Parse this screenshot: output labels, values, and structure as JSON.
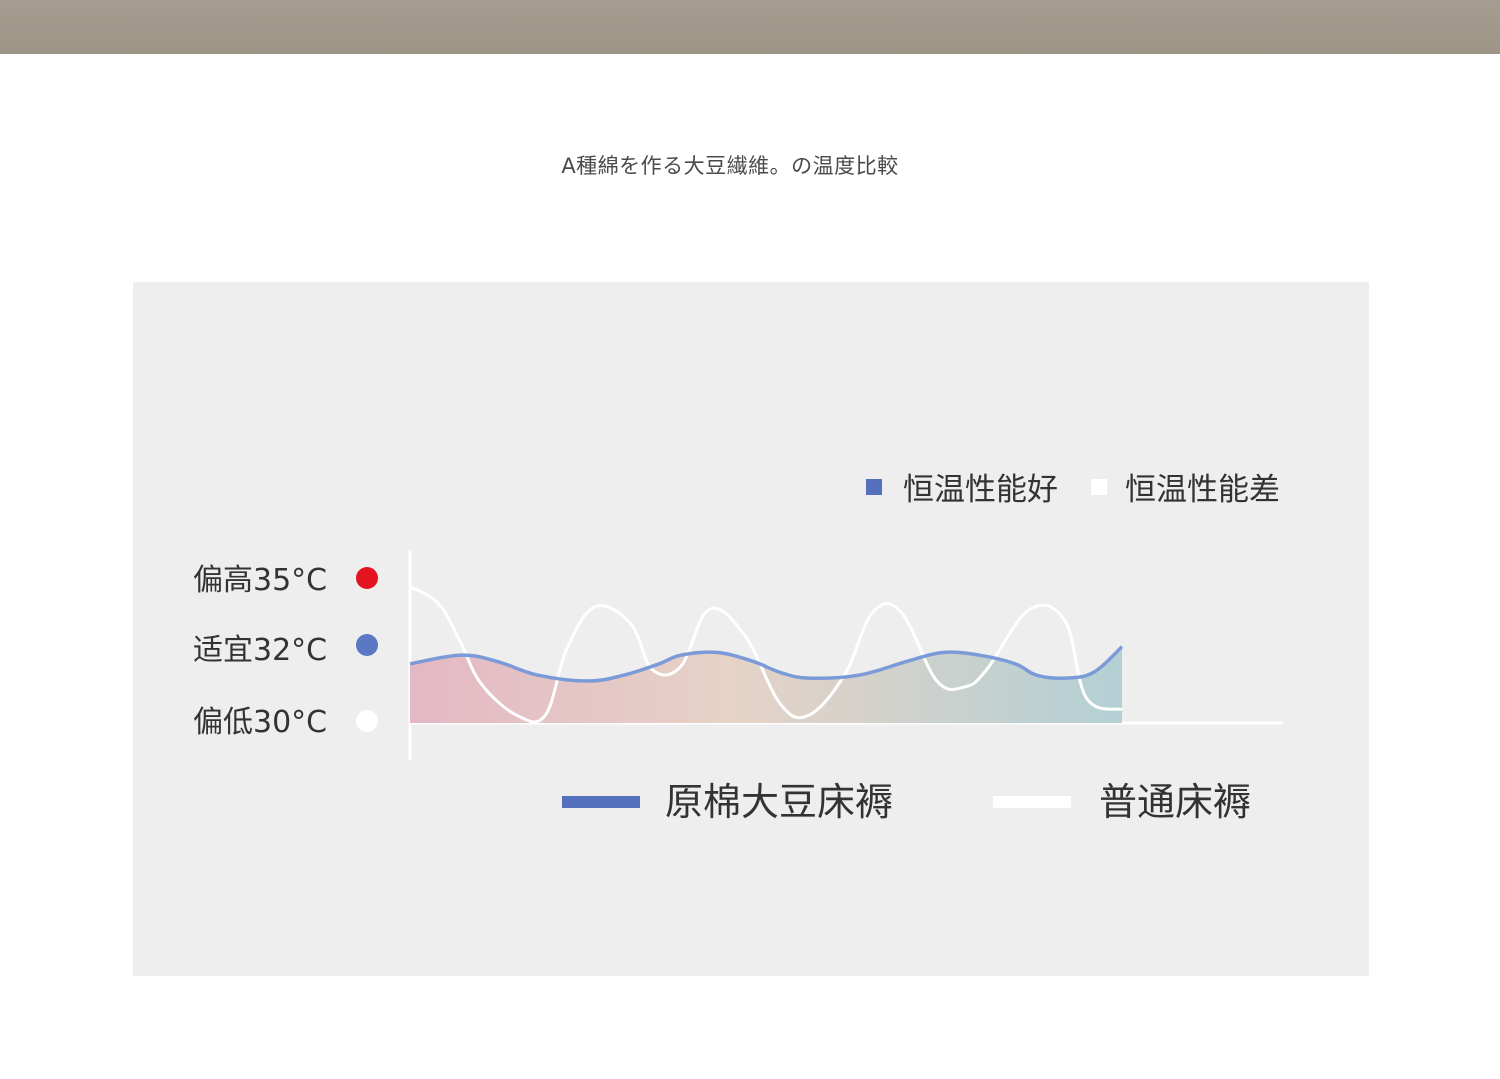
{
  "page": {
    "title": "A種綿を作る大豆繊維。の温度比較"
  },
  "colors": {
    "panel_bg": "#eeeeee",
    "high": "#e3141f",
    "suitable": "#5a78c4",
    "low": "#ffffff",
    "good_line": "#7a9ad8",
    "normal_line": "#ffffff",
    "legend_good": "#5570bd",
    "fill_left": "#e3b8c4",
    "fill_mid": "#e6d2c6",
    "fill_right": "#b3d0d4"
  },
  "chart_data": {
    "type": "line",
    "y_labels": [
      {
        "label": "偏高35°C",
        "value": 35,
        "dot_color": "#e3141f"
      },
      {
        "label": "适宜32°C",
        "value": 32,
        "dot_color": "#5a78c4"
      },
      {
        "label": "偏低30°C",
        "value": 30,
        "dot_color": "#ffffff"
      }
    ],
    "top_legend": [
      {
        "label": "恒温性能好",
        "color": "#5570bd"
      },
      {
        "label": "恒温性能差",
        "color": "#ffffff"
      }
    ],
    "ylim": [
      29.5,
      35.5
    ],
    "xlim": [
      0,
      100
    ],
    "series": [
      {
        "name": "原棉大豆床褥",
        "color": "#7a9ad8",
        "filled": true,
        "x": [
          0,
          7,
          12,
          18,
          25,
          30,
          35,
          38,
          43,
          48,
          52,
          56,
          63,
          70,
          75,
          80,
          85,
          88,
          92,
          96,
          100
        ],
        "y": [
          32.0,
          32.3,
          32.1,
          31.6,
          31.4,
          31.6,
          32.0,
          32.3,
          32.4,
          32.1,
          31.7,
          31.5,
          31.6,
          32.1,
          32.4,
          32.3,
          32.0,
          31.6,
          31.5,
          31.7,
          32.6
        ]
      },
      {
        "name": "普通床褥",
        "color": "#ffffff",
        "filled": false,
        "x": [
          0,
          4,
          7,
          10,
          15,
          19,
          22,
          26,
          31,
          34,
          38,
          42,
          47,
          52,
          56,
          61,
          65,
          69,
          74,
          78,
          81,
          87,
          92,
          95,
          100
        ],
        "y": [
          34.7,
          34.1,
          32.8,
          31.3,
          30.2,
          30.2,
          32.5,
          34.0,
          33.4,
          31.8,
          31.9,
          33.9,
          33.0,
          30.6,
          30.2,
          31.6,
          33.8,
          33.8,
          31.4,
          31.2,
          31.8,
          33.9,
          33.5,
          30.8,
          30.4
        ]
      }
    ]
  }
}
